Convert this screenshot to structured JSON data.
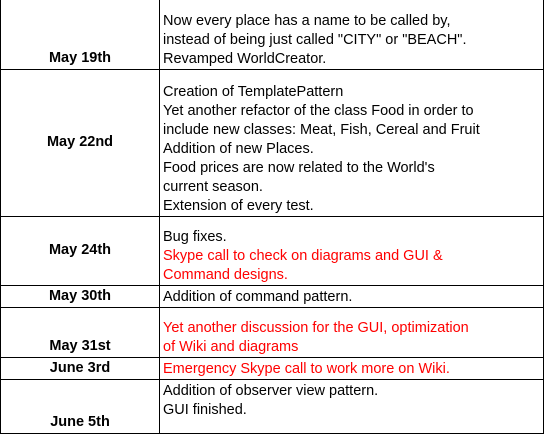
{
  "rows": [
    {
      "date": "May 19th",
      "lines": [
        {
          "text": "Now every place has a name to be called by,",
          "color": "black"
        },
        {
          "text": "instead of being just called \"CITY\" or \"BEACH\".",
          "color": "black"
        },
        {
          "text": "Revamped WorldCreator.",
          "color": "black"
        }
      ]
    },
    {
      "date": "May 22nd",
      "lines": [
        {
          "text": "Creation of TemplatePattern",
          "color": "black"
        },
        {
          "text": "Yet another refactor of the class Food in order to",
          "color": "black"
        },
        {
          "text": "include new classes: Meat, Fish, Cereal and Fruit",
          "color": "black"
        },
        {
          "text": "Addition of new Places.",
          "color": "black"
        },
        {
          "text": "Food prices are now related to the World's",
          "color": "black"
        },
        {
          "text": "current season.",
          "color": "black"
        },
        {
          "text": "Extension of every test.",
          "color": "black"
        }
      ]
    },
    {
      "date": "May 24th",
      "lines": [
        {
          "text": "Bug fixes.",
          "color": "black"
        },
        {
          "text": "Skype call to check on diagrams and GUI &",
          "color": "red"
        },
        {
          "text": "Command designs.",
          "color": "red"
        }
      ]
    },
    {
      "date": "May 30th",
      "lines": [
        {
          "text": "Addition of command pattern.",
          "color": "black"
        }
      ]
    },
    {
      "date": "May 31st",
      "lines": [
        {
          "text": "Yet another discussion for the GUI, optimization",
          "color": "red"
        },
        {
          "text": "of Wiki and diagrams",
          "color": "red"
        }
      ]
    },
    {
      "date": "June 3rd",
      "lines": [
        {
          "text": "Emergency Skype call to work more on Wiki.",
          "color": "red"
        }
      ]
    },
    {
      "date": "June 5th",
      "lines": [
        {
          "text": "Addition of observer view pattern.",
          "color": "black"
        },
        {
          "text": "GUI finished.",
          "color": "black"
        }
      ]
    }
  ],
  "colors": {
    "text": "#000000",
    "highlight": "#ff0000",
    "border": "#000000"
  }
}
